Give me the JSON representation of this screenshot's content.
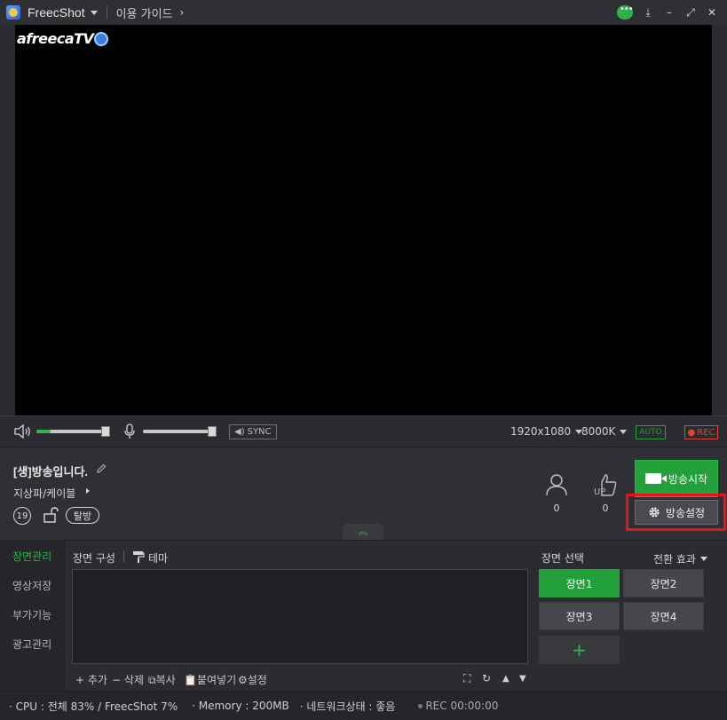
{
  "titlebar": {
    "app_name": "FreecShot",
    "guide_label": "이용 가이드",
    "guide_chevron": "›",
    "minimize_symbol": "⤓",
    "min2_symbol": "–",
    "restore_symbol": "⤢",
    "close_symbol": "✕"
  },
  "preview": {
    "watermark_text": "afreecaTV"
  },
  "controls": {
    "sync_label": "SYNC",
    "resolution": "1920x1080",
    "bitrate": "8000K",
    "auto_label": "AUTO",
    "rec_label": "REC",
    "volume_level": 0.2,
    "mic_level": 0.0
  },
  "broadcast": {
    "title": "[생]방송입니다.",
    "category": "지상파/케이블",
    "age_label": "19",
    "exit_label": "탈방",
    "viewer_count": "0",
    "up_count": "0",
    "start_label": "방송시작",
    "settings_label": "방송설정"
  },
  "nav": {
    "items": [
      "장면관리",
      "영상저장",
      "부가기능",
      "광고관리"
    ]
  },
  "scene_panel": {
    "tab_compose": "장면 구성",
    "tab_theme": "테마",
    "add": "+ 추가",
    "delete": "− 삭제",
    "copy": "복사",
    "paste": "붙여넣기",
    "settings": "설정"
  },
  "scene_select": {
    "title": "장면 선택",
    "transition": "전환 효과",
    "scenes": [
      "장면1",
      "장면2",
      "장면3",
      "장면4"
    ],
    "add_symbol": "+"
  },
  "status": {
    "cpu": "· CPU : 전체 83%  /  FreecShot  7%",
    "memory": "· Memory : 200MB",
    "network": "· 네트워크상태 : 좋음",
    "rec": "REC 00:00:00"
  }
}
